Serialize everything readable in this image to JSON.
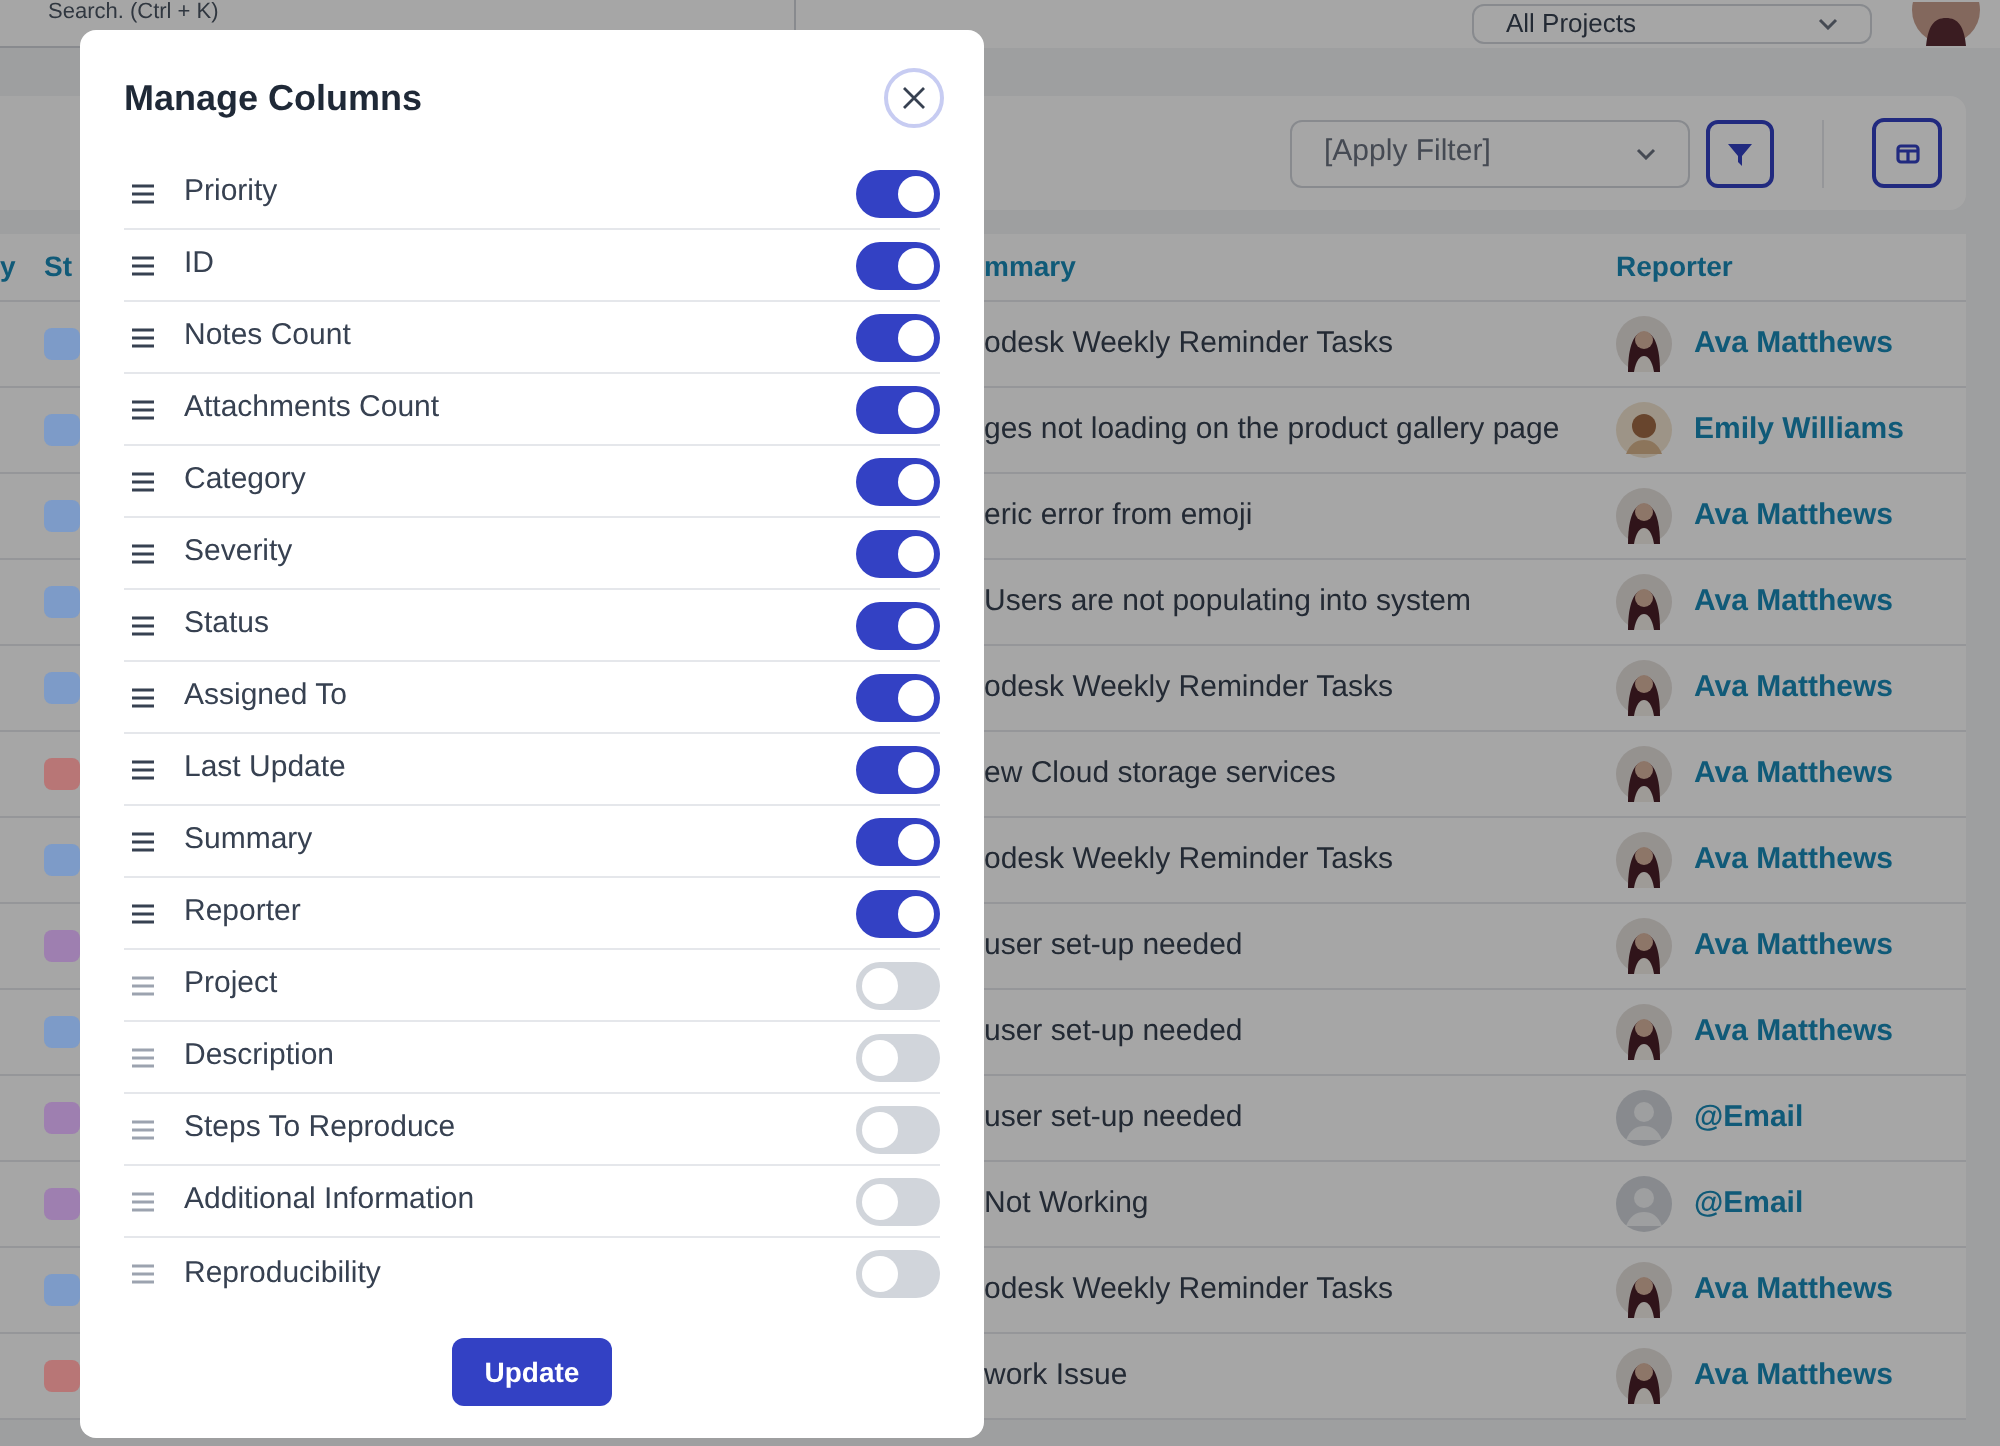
{
  "top_bar": {
    "search": {
      "placeholder": "Search. (Ctrl + K)"
    },
    "project_select": {
      "value": "All Projects"
    }
  },
  "toolbar": {
    "filter_select": {
      "value": "[Apply Filter]"
    }
  },
  "table": {
    "columns": [
      "y",
      "St",
      "mmary",
      "Reporter"
    ],
    "rows": [
      {
        "color": "#7d9bc8",
        "summary": "odesk Weekly Reminder Tasks",
        "reporter": "Ava Matthews",
        "kind": "photo"
      },
      {
        "color": "#7d9bc8",
        "summary": "ges not loading on the product gallery page",
        "reporter": "Emily Williams",
        "kind": "photo_light"
      },
      {
        "color": "#7d9bc8",
        "summary": "eric error from emoji",
        "reporter": "Ava Matthews",
        "kind": "photo"
      },
      {
        "color": "#7d9bc8",
        "summary": "Users are not populating into system",
        "reporter": "Ava Matthews",
        "kind": "photo"
      },
      {
        "color": "#7d9bc8",
        "summary": "odesk Weekly Reminder Tasks",
        "reporter": "Ava Matthews",
        "kind": "photo"
      },
      {
        "color": "#b87676",
        "summary": "ew Cloud storage services",
        "reporter": "Ava Matthews",
        "kind": "photo"
      },
      {
        "color": "#7d9bc8",
        "summary": "odesk Weekly Reminder Tasks",
        "reporter": "Ava Matthews",
        "kind": "photo"
      },
      {
        "color": "#9e7fb0",
        "summary": "user set-up needed",
        "reporter": "Ava Matthews",
        "kind": "photo"
      },
      {
        "color": "#7d9bc8",
        "summary": "user set-up needed",
        "reporter": "Ava Matthews",
        "kind": "photo"
      },
      {
        "color": "#9e7fb0",
        "summary": "user set-up needed",
        "reporter": "@Email",
        "kind": "placeholder"
      },
      {
        "color": "#9e7fb0",
        "summary": "Not Working",
        "reporter": "@Email",
        "kind": "placeholder"
      },
      {
        "color": "#7d9bc8",
        "summary": "odesk Weekly Reminder Tasks",
        "reporter": "Ava Matthews",
        "kind": "photo"
      },
      {
        "color": "#b87676",
        "summary": "work Issue",
        "reporter": "Ava Matthews",
        "kind": "photo"
      }
    ]
  },
  "modal": {
    "title": "Manage Columns",
    "button": "Update",
    "columns": [
      {
        "label": "Priority",
        "on": true
      },
      {
        "label": "ID",
        "on": true
      },
      {
        "label": "Notes Count",
        "on": true
      },
      {
        "label": "Attachments Count",
        "on": true
      },
      {
        "label": "Category",
        "on": true
      },
      {
        "label": "Severity",
        "on": true
      },
      {
        "label": "Status",
        "on": true
      },
      {
        "label": "Assigned To",
        "on": true
      },
      {
        "label": "Last Update",
        "on": true
      },
      {
        "label": "Summary",
        "on": true
      },
      {
        "label": "Reporter",
        "on": true
      },
      {
        "label": "Project",
        "on": false
      },
      {
        "label": "Description",
        "on": false
      },
      {
        "label": "Steps To Reproduce",
        "on": false
      },
      {
        "label": "Additional Information",
        "on": false
      },
      {
        "label": "Reproducibility",
        "on": false
      }
    ]
  }
}
